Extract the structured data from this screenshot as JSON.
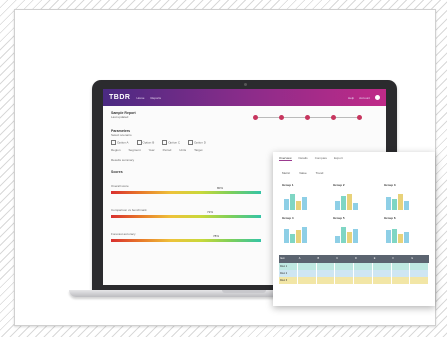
{
  "colors": {
    "header_gradient_start": "#4a2a82",
    "header_gradient_end": "#c02a88",
    "step_dot": "#c7355e",
    "table_header": "#5b6470",
    "bar_blue": "#8ecfe6",
    "bar_teal": "#7fd6c4",
    "bar_yellow": "#e8d27a",
    "row_teal": "#bfe9e2",
    "row_yellow": "#f2e6a6",
    "row_lightblue": "#cfe6f3"
  },
  "laptop": {
    "app": {
      "logo": "TBDR",
      "nav": [
        "Home",
        "Reports"
      ],
      "header_links": [
        "Help",
        "Account"
      ],
      "user_icon": "user-icon"
    },
    "page": {
      "title": "Sample Report",
      "subtitle": "Last updated",
      "section_label": "Parameters",
      "section_sub": "Select scenario",
      "option_checkboxes": [
        "Option A",
        "Option B",
        "Option C",
        "Option D"
      ],
      "fields": [
        "Region",
        "Segment",
        "Year",
        "Period",
        "Units",
        "Target"
      ],
      "section2": "Results summary",
      "meter_group_title": "Scores",
      "meters": [
        {
          "label": "Overall score",
          "value_label": "80%",
          "level": 0.8
        },
        {
          "label": "Comparison vs benchmark",
          "value_label": "72%",
          "level": 0.72
        },
        {
          "label": "Forecast accuracy",
          "value_label": "78%",
          "level": 0.78
        }
      ],
      "steps": 5
    }
  },
  "card": {
    "tabs": [
      "Overview",
      "Details",
      "Compare",
      "Export"
    ],
    "top_items": [
      "Metric",
      "Value",
      "Trend"
    ],
    "panels": [
      {
        "label": "Group 1",
        "bars": [
          0.6,
          0.9,
          0.5,
          0.7
        ]
      },
      {
        "label": "Group 2",
        "bars": [
          0.5,
          0.8,
          0.9,
          0.4
        ]
      },
      {
        "label": "Group 3",
        "bars": [
          0.7,
          0.6,
          0.9,
          0.5
        ]
      },
      {
        "label": "Group 4",
        "bars": [
          0.8,
          0.5,
          0.7,
          0.9
        ]
      },
      {
        "label": "Group 5",
        "bars": [
          0.4,
          0.9,
          0.6,
          0.8
        ]
      },
      {
        "label": "Group 6",
        "bars": [
          0.7,
          0.8,
          0.5,
          0.6
        ]
      }
    ],
    "table": {
      "headers": [
        "Item",
        "A",
        "B",
        "C",
        "D",
        "E",
        "F",
        "G"
      ],
      "rows": [
        [
          "Row 1",
          "",
          "",
          "",
          "",
          "",
          "",
          ""
        ],
        [
          "Row 2",
          "",
          "",
          "",
          "",
          "",
          "",
          ""
        ],
        [
          "Row 3",
          "",
          "",
          "",
          "",
          "",
          "",
          ""
        ]
      ]
    }
  }
}
